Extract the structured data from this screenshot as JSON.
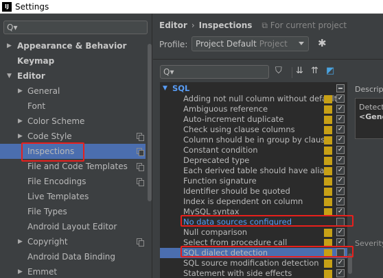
{
  "window": {
    "title": "Settings",
    "app_icon": "IJ"
  },
  "left": {
    "search_icon": "Q▾",
    "tree": [
      {
        "label": "Appearance & Behavior",
        "bold": true,
        "arrow": "right"
      },
      {
        "label": "Keymap",
        "bold": true,
        "arrow": ""
      },
      {
        "label": "Editor",
        "bold": true,
        "arrow": "down"
      },
      {
        "label": "General",
        "bold": false,
        "arrow": "right"
      },
      {
        "label": "Font",
        "bold": false,
        "arrow": ""
      },
      {
        "label": "Color Scheme",
        "bold": false,
        "arrow": "right"
      },
      {
        "label": "Code Style",
        "bold": false,
        "arrow": "right",
        "copy": true
      },
      {
        "label": "Inspections",
        "bold": false,
        "arrow": "",
        "copy": true,
        "selected": true
      },
      {
        "label": "File and Code Templates",
        "bold": false,
        "arrow": "",
        "copy": true
      },
      {
        "label": "File Encodings",
        "bold": false,
        "arrow": "",
        "copy": true
      },
      {
        "label": "Live Templates",
        "bold": false,
        "arrow": ""
      },
      {
        "label": "File Types",
        "bold": false,
        "arrow": ""
      },
      {
        "label": "Android Layout Editor",
        "bold": false,
        "arrow": ""
      },
      {
        "label": "Copyright",
        "bold": false,
        "arrow": "right",
        "copy": true
      },
      {
        "label": "Android Data Binding",
        "bold": false,
        "arrow": ""
      },
      {
        "label": "Emmet",
        "bold": false,
        "arrow": "right"
      }
    ]
  },
  "right": {
    "breadcrumb": {
      "parent": "Editor",
      "sep": "›",
      "current": "Inspections",
      "note": "For current project"
    },
    "profile": {
      "label": "Profile:",
      "value": "Project Default",
      "sub": "Project"
    },
    "search_icon": "Q▾",
    "inspections_group": "SQL",
    "inspections": [
      "Adding not null column without default",
      "Ambiguous reference",
      "Auto-increment duplicate",
      "Check using clause columns",
      "Column should be in group by clause",
      "Constant condition",
      "Deprecated type",
      "Each derived table should have alias",
      "Function signature",
      "Identifier should be quoted",
      "Index is dependent on column",
      "MySQL syntax",
      "No data sources configured",
      "Null comparison",
      "Select from procedure call",
      "SQL dialect detection",
      "SQL source modification detection",
      "Statement with side effects"
    ],
    "description_label": "Description",
    "description_text_1": "Detects",
    "description_text_2": "<Generic",
    "severity_label": "Severity:"
  },
  "colors": {
    "accent": "#4b6eaf",
    "link": "#589df6",
    "warning": "#c7a016",
    "highlight": "#e8201c"
  }
}
